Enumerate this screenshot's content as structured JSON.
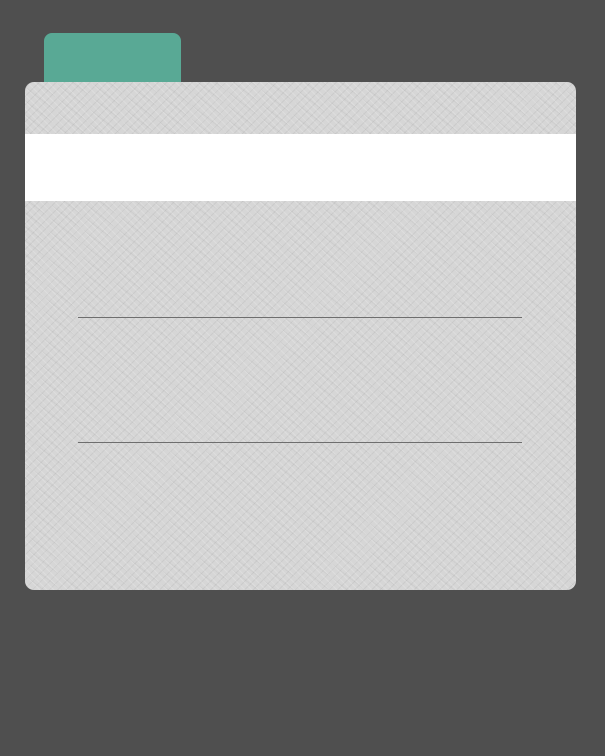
{
  "window": {
    "background_color": "#4f4f4f"
  },
  "tab": {
    "color": "#59a995"
  },
  "card": {
    "color": "#d6d6d6",
    "band_color": "#ffffff",
    "rule_color": "#6e6e6e"
  }
}
